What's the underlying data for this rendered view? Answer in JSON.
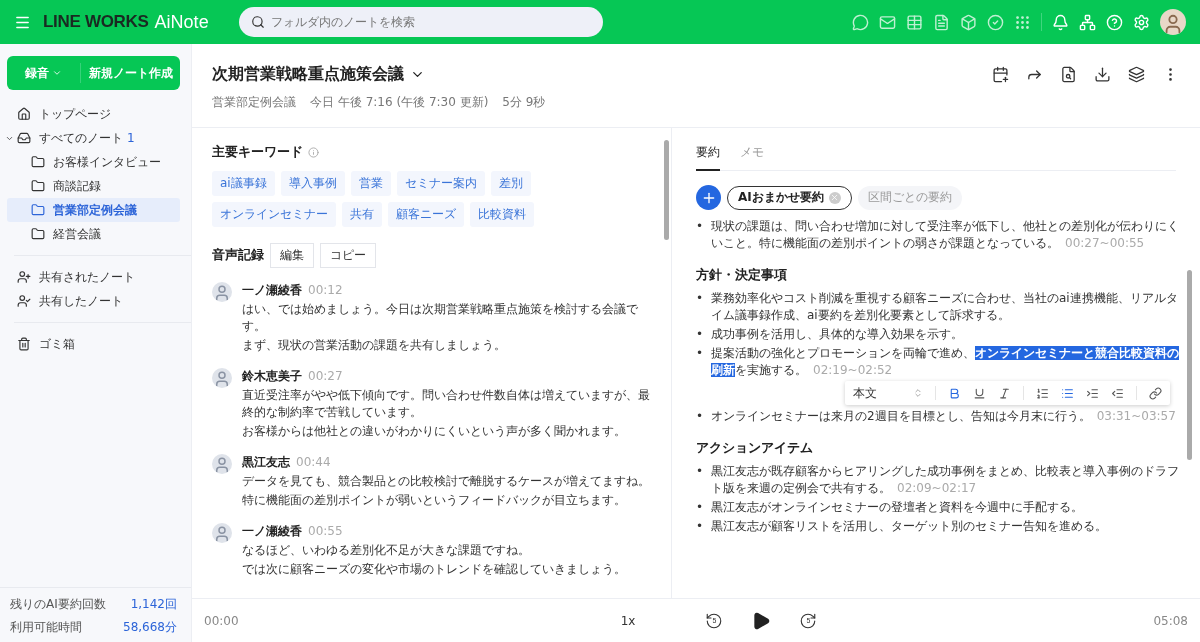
{
  "header": {
    "logo": "LINE WORKS",
    "product": "AiNote",
    "search": {
      "placeholder": "フォルダ内のノートを検索"
    }
  },
  "sidebar": {
    "record_button": "録音",
    "new_button": "新規ノート作成",
    "items": [
      {
        "kind": "home",
        "label": "トップページ",
        "selected": false
      },
      {
        "kind": "inbox",
        "label": "すべてのノート",
        "count": "1",
        "expanded": true,
        "selected": false,
        "children": [
          {
            "kind": "folder",
            "label": "お客様インタビュー",
            "selected": false
          },
          {
            "kind": "folder",
            "label": "商談記録",
            "selected": false
          },
          {
            "kind": "folder",
            "label": "営業部定例会議",
            "selected": true
          },
          {
            "kind": "folder",
            "label": "経営会議",
            "selected": false
          }
        ]
      },
      {
        "kind": "shared-in",
        "label": "共有されたノート",
        "selected": false
      },
      {
        "kind": "shared-out",
        "label": "共有したノート",
        "selected": false
      },
      {
        "kind": "trash",
        "label": "ゴミ箱",
        "selected": false
      }
    ],
    "stats": [
      {
        "label": "残りのAI要約回数",
        "value": "1,142回"
      },
      {
        "label": "利用可能時間",
        "value": "58,668分"
      }
    ]
  },
  "note": {
    "title": "次期営業戦略重点施策会議",
    "folder": "営業部定例会議",
    "date": "今日 午後 7:16 (午後 7:30 更新)",
    "duration": "5分 9秒"
  },
  "keywords": {
    "title": "主要キーワード",
    "items": [
      "ai議事録",
      "導入事例",
      "営業",
      "セミナー案内",
      "差別",
      "オンラインセミナー",
      "共有",
      "顧客ニーズ",
      "比較資料"
    ]
  },
  "transcript": {
    "title": "音声記録",
    "buttons": [
      "編集",
      "コピー"
    ],
    "entries": [
      {
        "speaker": "一ノ瀬綾香",
        "time": "00:12",
        "paragraphs": [
          "はい、では始めましょう。今日は次期営業戦略重点施策を検討する会議です。",
          "まず、現状の営業活動の課題を共有しましょう。"
        ]
      },
      {
        "speaker": "鈴木恵美子",
        "time": "00:27",
        "paragraphs": [
          "直近受注率がやや低下傾向です。問い合わせ件数自体は増えていますが、最終的な制約率で苦戦しています。",
          "お客様からは他社との違いがわかりにくいという声が多く聞かれます。"
        ]
      },
      {
        "speaker": "黒江友志",
        "time": "00:44",
        "paragraphs": [
          "データを見ても、競合製品との比較検討で離脱するケースが増えてますね。",
          "特に機能面の差別ポイントが弱いというフィードバックが目立ちます。"
        ]
      },
      {
        "speaker": "一ノ瀬綾香",
        "time": "00:55",
        "paragraphs": [
          "なるほど、いわゆる差別化不足が大きな課題ですね。",
          "では次に顧客ニーズの変化や市場のトレンドを確認していきましょう。"
        ]
      }
    ]
  },
  "summary_tabs": [
    {
      "label": "要約",
      "selected": true
    },
    {
      "label": "メモ",
      "selected": false
    }
  ],
  "summary_chips": [
    {
      "label": "AIおまかせ要約",
      "selected": true
    },
    {
      "label": "区間ごとの要約",
      "selected": false
    }
  ],
  "summary": {
    "bullet": "•",
    "intro": [
      {
        "text": "現状の課題は、問い合わせ増加に対して受注率が低下し、他社との差別化が伝わりにくいこと。特に機能面の差別ポイントの弱さが課題となっている。",
        "time": "00:27~00:55"
      }
    ],
    "sections": [
      {
        "heading": "方針・決定事項",
        "items": [
          {
            "text": "業務効率化やコスト削減を重視する顧客ニーズに合わせ、当社のai連携機能、リアルタイム議事録作成、ai要約を差別化要素として訴求する。"
          },
          {
            "text": "成功事例を活用し、具体的な導入効果を示す。"
          },
          {
            "text": "提案活動の強化とプロモーションを両輪で進め、",
            "selection": "オンラインセミナーと競合比較資料の刷新",
            "after": "を実施する。",
            "time": "02:19~02:52"
          },
          {
            "text": "オンラインセミナーは来月の2週目を目標とし、告知は今月末に行う。",
            "time": "03:31~03:57"
          }
        ]
      },
      {
        "heading": "アクションアイテム",
        "items": [
          {
            "text": "黒江友志が既存顧客からヒアリングした成功事例をまとめ、比較表と導入事例のドラフト版を来週の定例会で共有する。",
            "time": "02:09~02:17"
          },
          {
            "text": "黒江友志がオンラインセミナーの登壇者と資料を今週中に手配する。"
          },
          {
            "text": "黒江友志が顧客リストを活用し、ターゲット別のセミナー告知を進める。"
          }
        ]
      }
    ]
  },
  "format_toolbar": {
    "style": "本文"
  },
  "player": {
    "current": "00:00",
    "speed": "1x",
    "skip_back": "5",
    "skip_forward": "5",
    "total": "05:08"
  }
}
